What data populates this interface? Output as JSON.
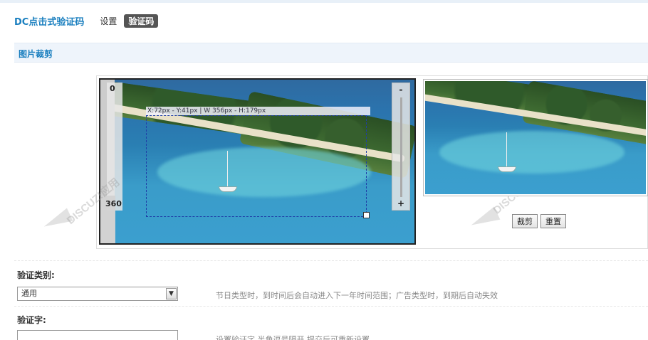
{
  "header": {
    "brand": "DC点击式验证码",
    "nav": [
      {
        "label": "设置",
        "active": false
      },
      {
        "label": "验证码",
        "active": true
      }
    ]
  },
  "section": {
    "title": "图片裁剪"
  },
  "crop_editor": {
    "slider_top_value": "0",
    "slider_bottom_value": "360",
    "zoom_out_symbol": "-",
    "zoom_in_symbol": "+",
    "crop_info": "X:72px - Y:41px | W 356px - H:179px",
    "watermark_text": "DISCUZ!应用中心 addon.discuz.com"
  },
  "buttons": {
    "crop": "裁剪",
    "reset": "重置"
  },
  "form": {
    "type_label": "验证类别:",
    "type_value": "通用",
    "type_hint": "节日类型时，到时间后会自动进入下一年时间范围；广告类型时，到期后自动失效",
    "word_label": "验证字:",
    "word_value": "",
    "word_hint": "设置验证字,半角逗号隔开,提交后可重新设置"
  },
  "colors": {
    "brand": "#1a7fbf",
    "section_bg": "#eef4fb",
    "nav_active_bg": "#555555"
  }
}
